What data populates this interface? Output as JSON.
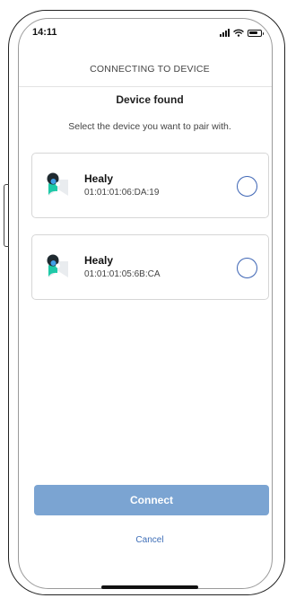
{
  "status_bar": {
    "time": "14:11",
    "icons": [
      "signal-icon",
      "wifi-icon",
      "battery-icon"
    ]
  },
  "header": {
    "title": "CONNECTING TO DEVICE"
  },
  "main": {
    "heading": "Device found",
    "subheading": "Select the device you want to pair with.",
    "devices": [
      {
        "name": "Healy",
        "mac": "01:01:01:06:DA:19",
        "selected": false,
        "icon": "healy-logo-icon"
      },
      {
        "name": "Healy",
        "mac": "01:01:01:05:6B:CA",
        "selected": false,
        "icon": "healy-logo-icon"
      }
    ]
  },
  "actions": {
    "connect_label": "Connect",
    "cancel_label": "Cancel"
  },
  "colors": {
    "accent": "#3f6fb8",
    "button_disabled": "#7ba4d2",
    "logo_teal": "#1ec9a8",
    "logo_dark": "#1f2a30"
  }
}
